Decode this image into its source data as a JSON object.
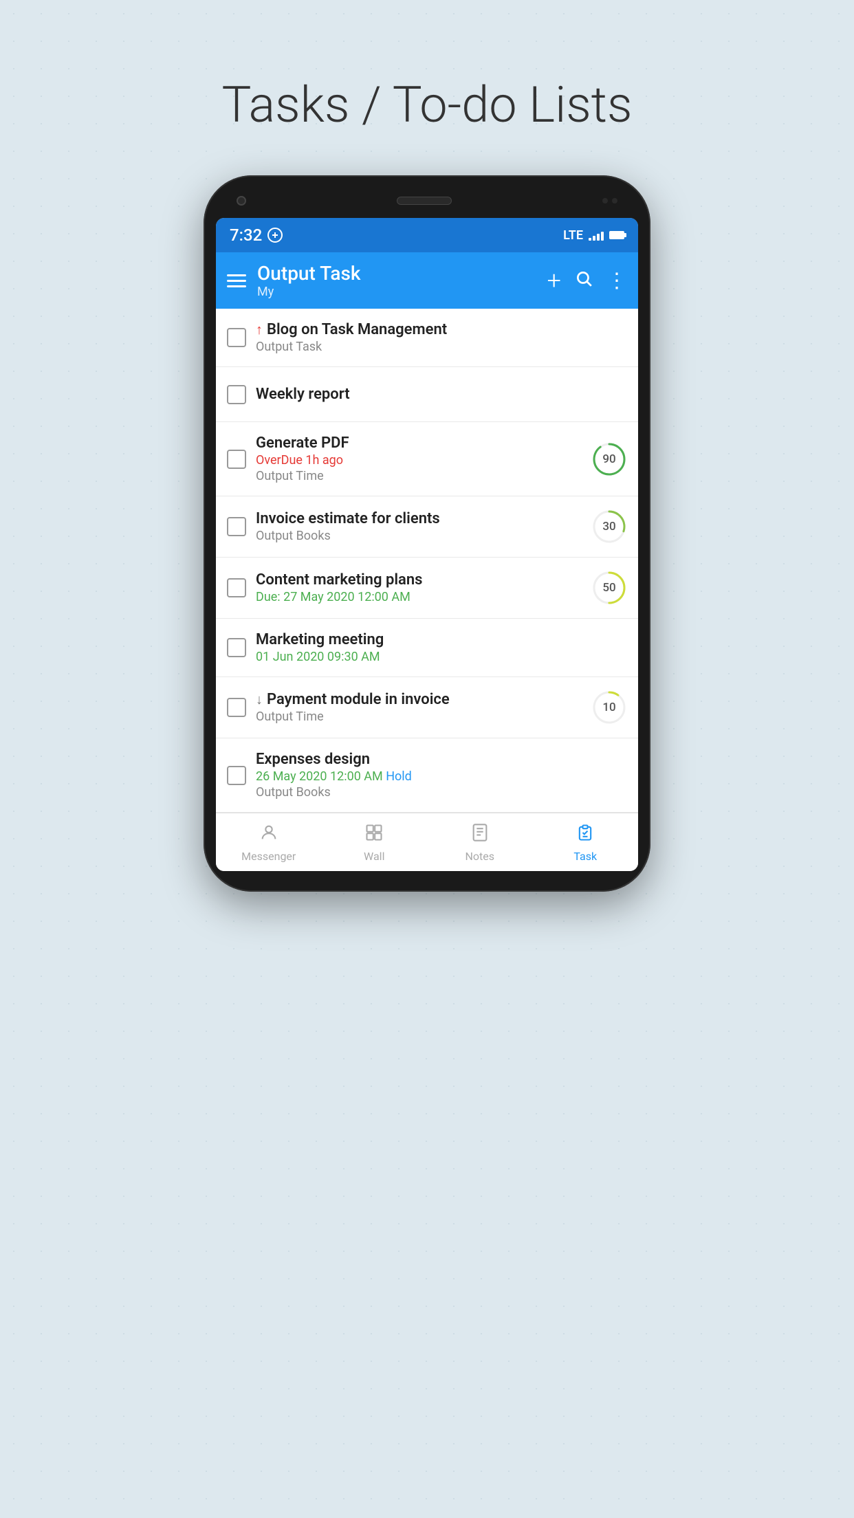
{
  "page": {
    "title": "Tasks / To-do Lists",
    "bg_color": "#dde8ee"
  },
  "status_bar": {
    "time": "7:32",
    "lte": "LTE",
    "bg_color": "#1976D2"
  },
  "toolbar": {
    "app_name": "Output Task",
    "subtitle": "My",
    "bg_color": "#2196F3",
    "add_label": "+",
    "more_label": "⋮"
  },
  "tasks": [
    {
      "id": 1,
      "title": "Blog on Task Management",
      "priority": "up",
      "subtitle": "Output Task",
      "due": null,
      "progress": null
    },
    {
      "id": 2,
      "title": "Weekly report",
      "priority": null,
      "subtitle": null,
      "due": null,
      "progress": null
    },
    {
      "id": 3,
      "title": "Generate PDF",
      "priority": null,
      "subtitle": "Output Time",
      "due": "OverDue 1h ago",
      "due_type": "overdue",
      "progress": 90,
      "progress_color": "#4CAF50"
    },
    {
      "id": 4,
      "title": "Invoice estimate for clients",
      "priority": null,
      "subtitle": "Output Books",
      "due": null,
      "progress": 30,
      "progress_color": "#8BC34A"
    },
    {
      "id": 5,
      "title": "Content marketing plans",
      "priority": null,
      "subtitle": null,
      "due": "Due: 27 May 2020 12:00 AM",
      "due_type": "soon",
      "progress": 50,
      "progress_color": "#CDDC39"
    },
    {
      "id": 6,
      "title": "Marketing meeting",
      "priority": null,
      "subtitle": null,
      "due": "01 Jun 2020 09:30 AM",
      "due_type": "soon",
      "progress": null
    },
    {
      "id": 7,
      "title": "Payment module in invoice",
      "priority": "down",
      "subtitle": "Output Time",
      "due": null,
      "progress": 10,
      "progress_color": "#CDDC39"
    },
    {
      "id": 8,
      "title": "Expenses design",
      "priority": null,
      "subtitle": "Output Books",
      "due": "26 May 2020 12:00 AM Hold",
      "due_type": "hold",
      "progress": null
    }
  ],
  "bottom_nav": [
    {
      "id": "messenger",
      "label": "Messenger",
      "icon": "person",
      "active": false
    },
    {
      "id": "wall",
      "label": "Wall",
      "icon": "grid",
      "active": false
    },
    {
      "id": "notes",
      "label": "Notes",
      "icon": "notes",
      "active": false
    },
    {
      "id": "task",
      "label": "Task",
      "icon": "task",
      "active": true
    }
  ]
}
